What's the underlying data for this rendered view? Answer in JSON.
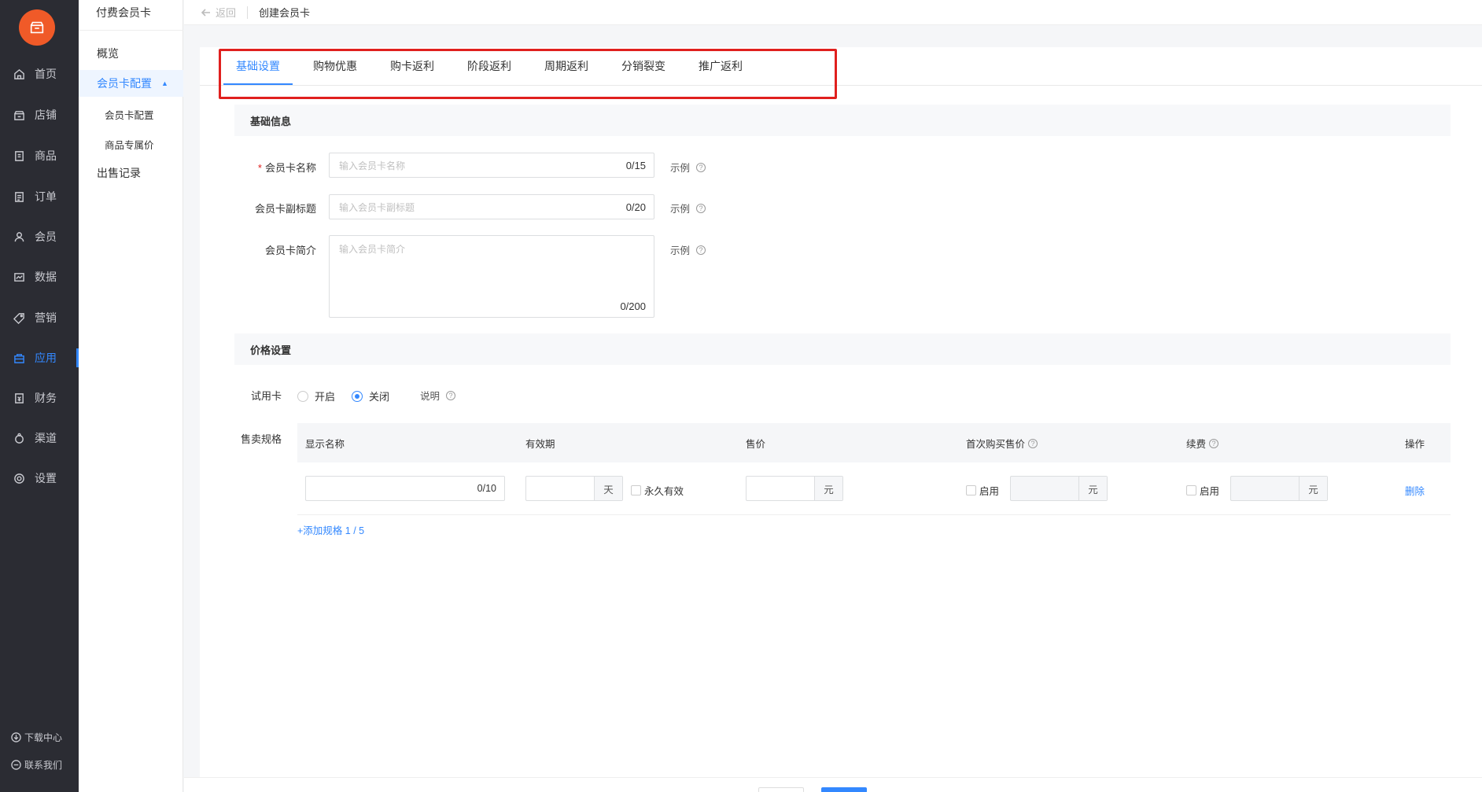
{
  "nav": {
    "items": [
      {
        "label": "首页",
        "icon": "home-icon"
      },
      {
        "label": "店铺",
        "icon": "store-icon"
      },
      {
        "label": "商品",
        "icon": "goods-icon"
      },
      {
        "label": "订单",
        "icon": "order-icon"
      },
      {
        "label": "会员",
        "icon": "user-icon"
      },
      {
        "label": "数据",
        "icon": "chart-icon"
      },
      {
        "label": "营销",
        "icon": "tag-icon"
      },
      {
        "label": "应用",
        "icon": "app-icon",
        "active": true
      },
      {
        "label": "财务",
        "icon": "finance-icon"
      },
      {
        "label": "渠道",
        "icon": "channel-icon"
      },
      {
        "label": "设置",
        "icon": "gear-icon"
      }
    ],
    "footer": [
      {
        "label": "下载中心",
        "icon": "download-icon"
      },
      {
        "label": "联系我们",
        "icon": "chat-icon"
      }
    ]
  },
  "sub": {
    "title": "付费会员卡",
    "items": [
      {
        "label": "概览"
      },
      {
        "label": "会员卡配置",
        "active": true
      },
      {
        "label": "会员卡配置"
      },
      {
        "label": "商品专属价"
      },
      {
        "label": "出售记录"
      }
    ]
  },
  "topbar": {
    "back_label": "返回",
    "title": "创建会员卡"
  },
  "tabs": [
    "基础设置",
    "购物优惠",
    "购卡返利",
    "阶段返利",
    "周期返利",
    "分销裂变",
    "推广返利"
  ],
  "basic": {
    "section_title": "基础信息",
    "name_label": "会员卡名称",
    "name_placeholder": "输入会员卡名称",
    "name_count": "0/15",
    "subtitle_label": "会员卡副标题",
    "subtitle_placeholder": "输入会员卡副标题",
    "subtitle_count": "0/20",
    "intro_label": "会员卡简介",
    "intro_placeholder": "输入会员卡简介",
    "intro_count": "0/200",
    "example_label": "示例"
  },
  "price": {
    "section_title": "价格设置",
    "trial_label": "试用卡",
    "opt_on": "开启",
    "opt_off": "关闭",
    "explain": "说明",
    "spec_label": "售卖规格",
    "columns": [
      "显示名称",
      "有效期",
      "售价",
      "首次购买售价",
      "续费",
      "操作"
    ],
    "row": {
      "name_count": "0/10",
      "unit_day": "天",
      "forever": "永久有效",
      "unit_yuan": "元",
      "enable": "启用",
      "delete": "删除"
    },
    "add_spec": "+添加规格 1 / 5"
  },
  "colors": {
    "accent": "#3388ff",
    "brand": "#f05a28",
    "nav_bg": "#2b2c33",
    "highlight": "#e0201e"
  }
}
